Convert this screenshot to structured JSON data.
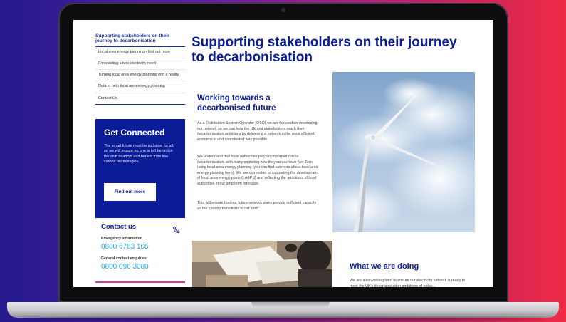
{
  "sidebar": {
    "title": "Supporting stakeholders on their journey to decarbonisation",
    "items": [
      {
        "label": "Local area energy planning - find out more"
      },
      {
        "label": "Forecasting future electricity need"
      },
      {
        "label": "Turning local area energy planning into a reality"
      },
      {
        "label": "Data to help local area energy planning"
      },
      {
        "label": "Contact Us"
      }
    ]
  },
  "connect": {
    "title": "Get Connected",
    "body": "The smart future must be inclusive for all, so we will ensure no one is left behind in the shift to adopt and benefit from low carbon technologies.",
    "button": "Find out more"
  },
  "contact": {
    "title": "Contact us",
    "emergency_label": "Emergency information",
    "emergency_number": "0800 6783 105",
    "general_label": "General contact enquiries",
    "general_number": "0800 096 3080"
  },
  "main": {
    "title": "Supporting stakeholders on their journey to decarbonisation",
    "section_title": "Working towards a decarbonised future",
    "paragraphs": [
      "As a Distribution System Operator (DSO) we are focused on developing our network so we can help the UK and stakeholders reach their decarbonisation ambitions by delivering a network in the most efficient, economical and coordinated way possible.",
      "We understand that local authorities play an important role in decarbonisation, with many exploring how they can achieve Net Zero using local area energy planning (you can find out more about local area energy planning here). We are committed to supporting the development of local area energy plans (LAEPS) and reflecting the ambitions of local authorities in our long term forecasts.",
      "This will ensure that our future network plans provide sufficient capacity as the country transitions to net zero."
    ],
    "doing_title": "What we are doing",
    "doing_text": "We are also working hard to ensure our electricity network is ready to meet the UK's decarbonisation ambitions of today..."
  },
  "colors": {
    "brand_navy": "#0a1d97",
    "link_blue": "#27a4e4",
    "accent_pink": "#d33a9c"
  },
  "icons": {
    "phone": "phone-icon",
    "camera": "camera-icon"
  }
}
